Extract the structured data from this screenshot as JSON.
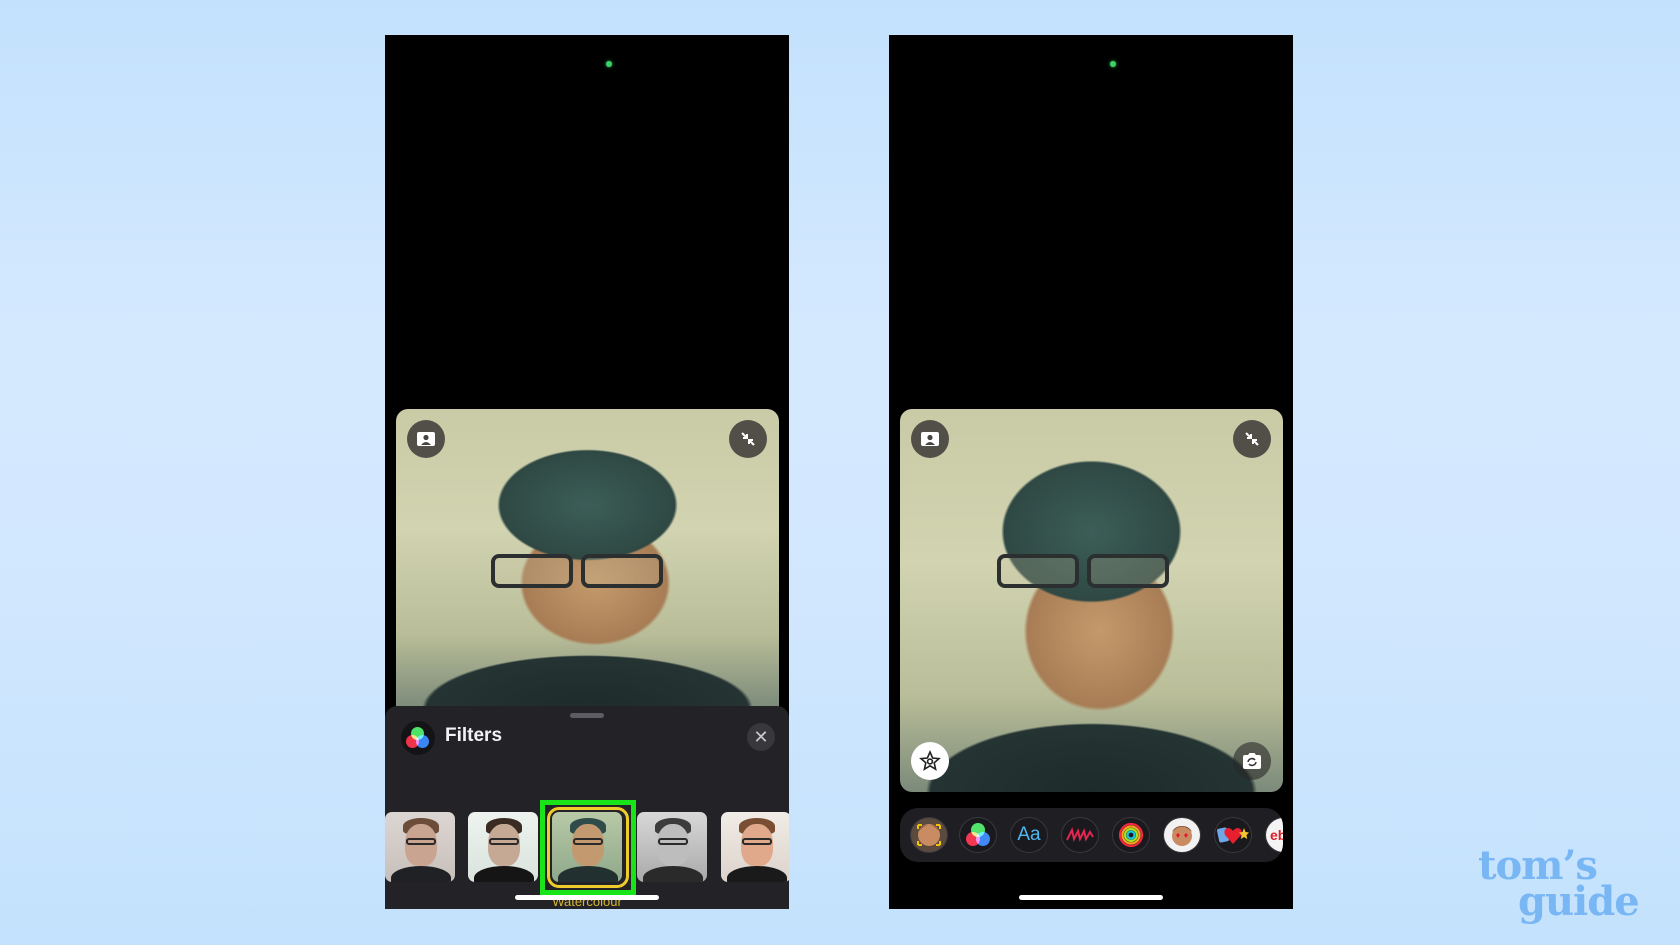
{
  "brand": {
    "logo_line1": "tom’s",
    "logo_line2": "guide",
    "logo_color": "#78b6f4"
  },
  "background": {
    "top": "#c3e1fd",
    "middle": "#d4e9fe"
  },
  "left_phone": {
    "status": {
      "camera_indicator_color": "#3cd36a"
    },
    "video_tile": {
      "top_left_button_icon": "portrait-view-icon",
      "top_right_button_icon": "collapse-arrows-icon"
    },
    "filters_sheet": {
      "title": "Filters",
      "icon": "filters-rgb-icon",
      "close_icon": "close-icon",
      "close_glyph": "✕",
      "thumbnails": [
        {
          "name": "filter-original",
          "tone": "natural"
        },
        {
          "name": "filter-vivid-light",
          "tone": "bright"
        },
        {
          "name": "filter-watercolour",
          "tone": "watercolour",
          "selected": true,
          "label": "Watercolour"
        },
        {
          "name": "filter-mono",
          "tone": "mono"
        },
        {
          "name": "filter-warm",
          "tone": "warm"
        }
      ],
      "selected_label": "Watercolour",
      "selected_label_color": "#d7b633",
      "highlight_color": "#19e319"
    }
  },
  "right_phone": {
    "status": {
      "camera_indicator_color": "#3cd36a"
    },
    "video_tile": {
      "top_left_button_icon": "portrait-view-icon",
      "top_right_button_icon": "collapse-arrows-icon",
      "bottom_left_button_icon": "effects-star-icon",
      "bottom_right_button_icon": "flip-camera-icon"
    },
    "effects_tray": {
      "items": [
        {
          "name": "memoji",
          "icon": "memoji-icon"
        },
        {
          "name": "filters",
          "icon": "filters-rgb-icon"
        },
        {
          "name": "text",
          "icon": "text-icon",
          "label": "Aa"
        },
        {
          "name": "shapes",
          "icon": "scribble-shapes-icon"
        },
        {
          "name": "fitness",
          "icon": "activity-rings-icon"
        },
        {
          "name": "memoji-stickers",
          "icon": "memoji-sticker-icon"
        },
        {
          "name": "emoji-stickers",
          "icon": "emoji-stickers-icon",
          "label": "❤"
        },
        {
          "name": "ebay",
          "icon": "ebay-app-icon",
          "label": "eb"
        }
      ]
    }
  }
}
